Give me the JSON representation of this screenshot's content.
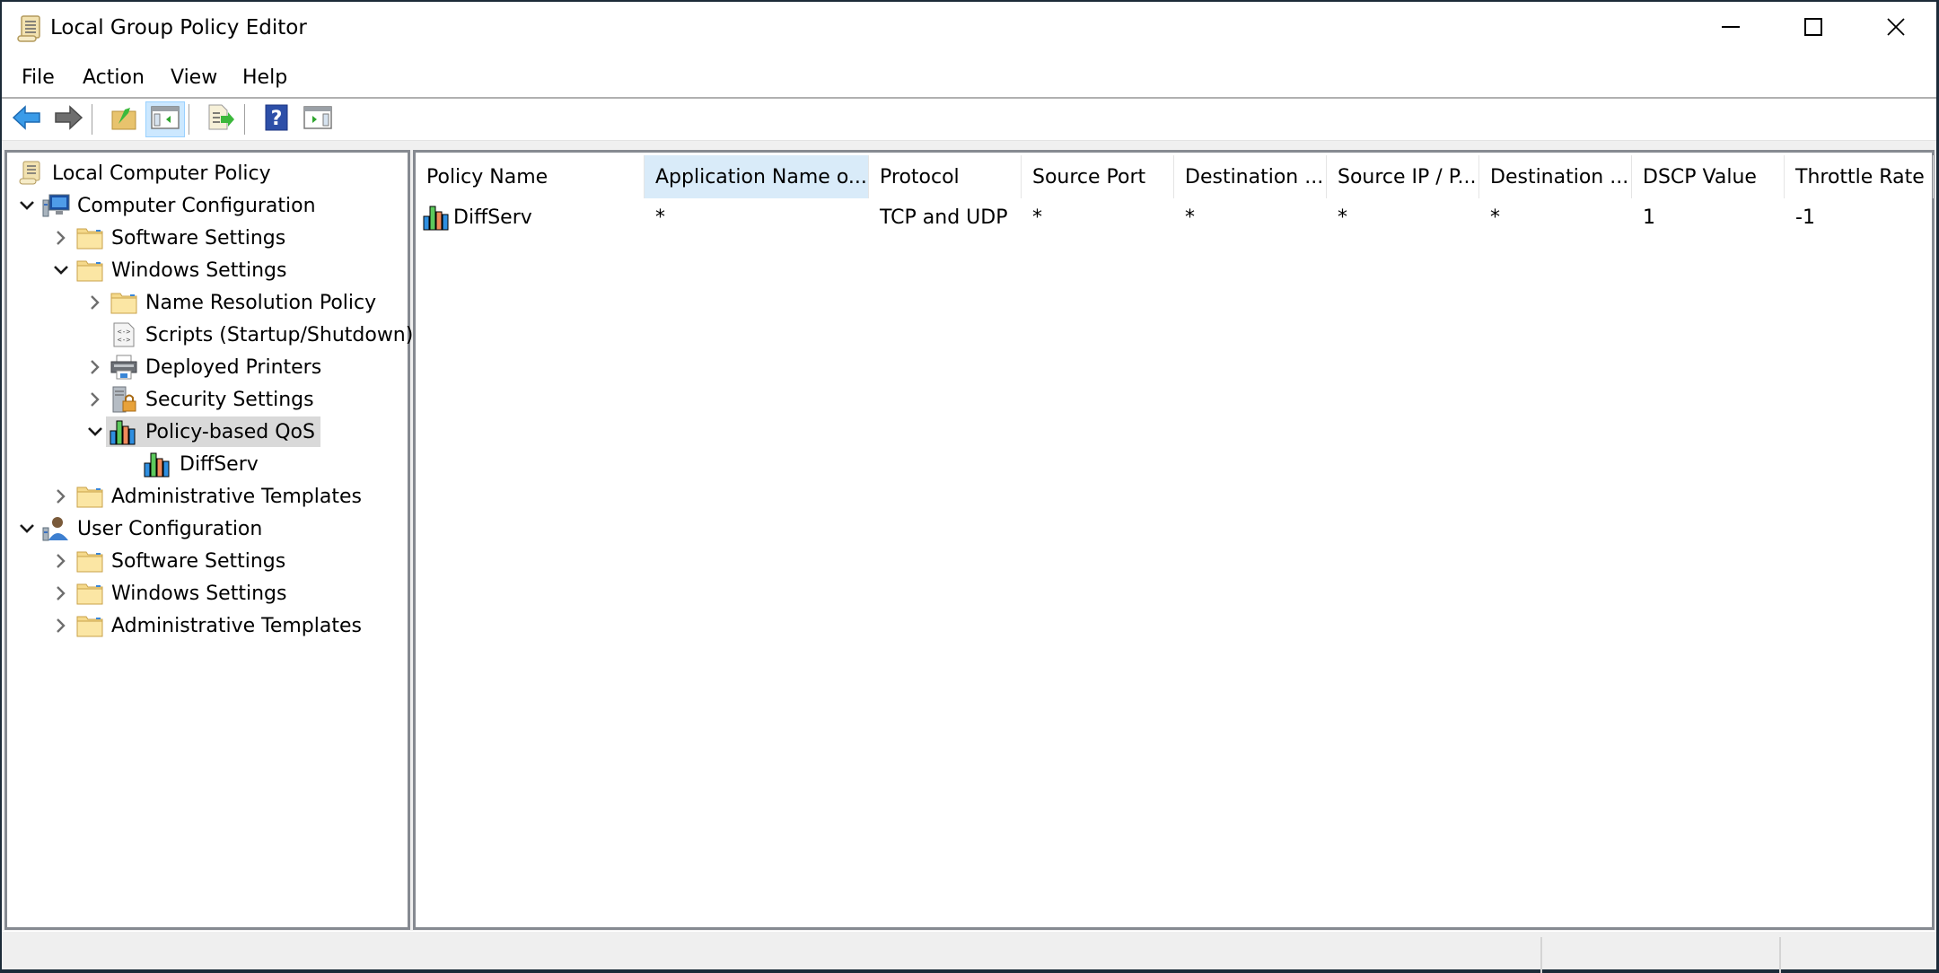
{
  "window": {
    "title": "Local Group Policy Editor",
    "icon": "scroll-icon",
    "controls": [
      "minimize-icon",
      "maximize-icon",
      "close-icon"
    ]
  },
  "menu": {
    "items": [
      {
        "label": "File"
      },
      {
        "label": "Action"
      },
      {
        "label": "View"
      },
      {
        "label": "Help"
      }
    ]
  },
  "toolbar": {
    "buttons": [
      {
        "name": "back",
        "icon": "arrow-left-icon"
      },
      {
        "name": "forward",
        "icon": "arrow-right-icon"
      },
      {
        "name": "up-one-level",
        "icon": "folder-up-icon"
      },
      {
        "name": "show-hide-console-tree",
        "icon": "console-tree-icon",
        "active": true
      },
      {
        "name": "export-list",
        "icon": "export-list-icon"
      },
      {
        "name": "help",
        "icon": "help-icon"
      },
      {
        "name": "show-hide-action-pane",
        "icon": "action-pane-icon"
      }
    ]
  },
  "tree": {
    "items": [
      {
        "label": "Local Computer Policy",
        "icon": "scroll-icon",
        "level": 0,
        "expander": "none"
      },
      {
        "label": "Computer Configuration",
        "icon": "computer-icon",
        "level": 1,
        "expander": "expanded"
      },
      {
        "label": "Software Settings",
        "icon": "folder-icon",
        "level": 2,
        "expander": "collapsed"
      },
      {
        "label": "Windows Settings",
        "icon": "folder-icon",
        "level": 2,
        "expander": "expanded"
      },
      {
        "label": "Name Resolution Policy",
        "icon": "folder-icon",
        "level": 3,
        "expander": "collapsed"
      },
      {
        "label": "Scripts (Startup/Shutdown)",
        "icon": "script-icon",
        "level": 3,
        "expander": "none"
      },
      {
        "label": "Deployed Printers",
        "icon": "printer-icon",
        "level": 3,
        "expander": "collapsed"
      },
      {
        "label": "Security Settings",
        "icon": "security-icon",
        "level": 3,
        "expander": "collapsed"
      },
      {
        "label": "Policy-based QoS",
        "icon": "qos-chart-icon",
        "level": 3,
        "expander": "expanded",
        "selected": true
      },
      {
        "label": "DiffServ",
        "icon": "qos-chart-icon",
        "level": 4,
        "expander": "none"
      },
      {
        "label": "Administrative Templates",
        "icon": "folder-icon",
        "level": 2,
        "expander": "collapsed"
      },
      {
        "label": "User Configuration",
        "icon": "user-icon",
        "level": 1,
        "expander": "expanded"
      },
      {
        "label": "Software Settings",
        "icon": "folder-icon",
        "level": 2,
        "expander": "collapsed"
      },
      {
        "label": "Windows Settings",
        "icon": "folder-icon",
        "level": 2,
        "expander": "collapsed"
      },
      {
        "label": "Administrative Templates",
        "icon": "folder-icon",
        "level": 2,
        "expander": "collapsed"
      }
    ]
  },
  "list": {
    "columns": [
      {
        "label": "Policy Name"
      },
      {
        "label": "Application Name o...",
        "hover": true
      },
      {
        "label": "Protocol"
      },
      {
        "label": "Source Port"
      },
      {
        "label": "Destination ..."
      },
      {
        "label": "Source IP / P..."
      },
      {
        "label": "Destination ..."
      },
      {
        "label": "DSCP Value"
      },
      {
        "label": "Throttle Rate"
      }
    ],
    "rows": [
      {
        "icon": "qos-chart-icon",
        "cells": [
          "DiffServ",
          "*",
          "TCP and UDP",
          "*",
          "*",
          "*",
          "*",
          "1",
          "-1"
        ]
      }
    ]
  },
  "colors": {
    "selection": "#d9d9d9",
    "header_hover": "#d9ebf9",
    "toolbar_active": "#cce8ff",
    "pane_border": "#868a91",
    "workspace_bg": "#f0f0f0"
  }
}
